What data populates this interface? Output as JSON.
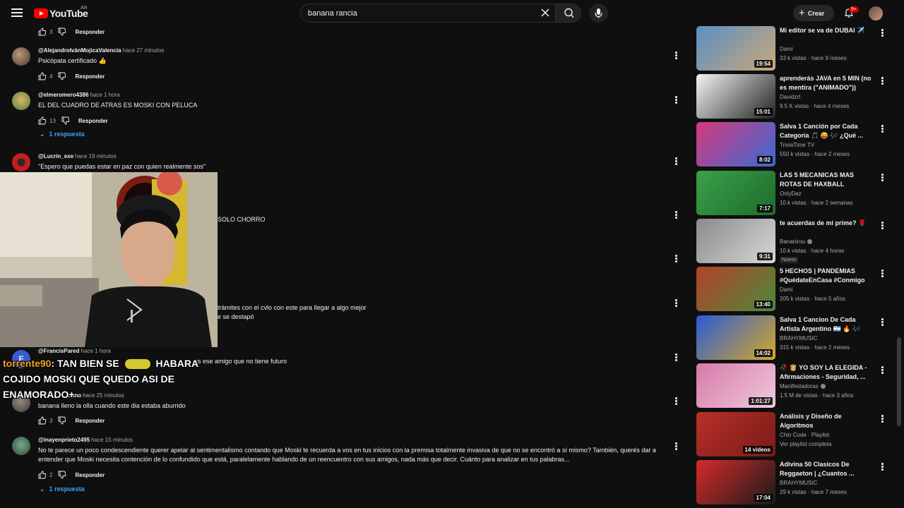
{
  "header": {
    "logo_text": "YouTube",
    "country": "AR",
    "search_value": "banana rancia",
    "create_label": "Crear",
    "notif_count": "9+"
  },
  "comments": [
    {
      "author": "",
      "time": "",
      "text": "",
      "likes": "3",
      "reply": "Responder"
    },
    {
      "author": "@AlejandroIvánMojicaValencia",
      "time": "hace 27 minutos",
      "text": "Psicópata certificado 👍",
      "likes": "4",
      "reply": "Responder"
    },
    {
      "author": "@elmeromero4386",
      "time": "hace 1 hora",
      "text": "EL DEL CUADRO DE ATRAS ES MOSKI CON PELUCA",
      "likes": "13",
      "reply": "Responder",
      "replies": "1 respuesta"
    },
    {
      "author": "@Lucrin_exe",
      "time": "hace 19 minutos",
      "text": "\"Espero que puedas estar en paz con quien realmente sos\""
    },
    {
      "text": "SOLO CHORRO"
    },
    {
      "text": "trámites con el cvlo con este para llegar a algo mejor",
      "text2": "e se destapó"
    },
    {
      "author": "@FrancisPared",
      "time": "hace 1 hora",
      "text": "os ese amigo que no tiene futuro"
    },
    {
      "author": "bano",
      "time": "hace 25 minutos",
      "text": "banana lleno la olla cuando este dia estaba aburrido",
      "likes": "3",
      "reply": "Responder"
    },
    {
      "author": "@inayenprieto2495",
      "time": "hace 15 minutos",
      "text": "No te parece un poco condescendiente querer apelar al sentimentalismo contando que Moski te recuerda a vos en tus inicios con la premisa totalmente invasiva de que no se encontró a sí mismo? También, querés dar a entender que Moski necesita contención de lo confundido que está, paralelamente hablando de un reencuentro con sus amigos, nada más que decir. Cuánto para analizar en tus palabras...",
      "likes": "2",
      "reply": "Responder",
      "replies": "1 respuesta"
    }
  ],
  "chat": {
    "user": "torrente90",
    "message_a": ": TAN BIEN SE",
    "message_b": "HABARA COJIDO MOSKI QUE QUEDO ASI DE ENAMORADO+"
  },
  "sidebar": [
    {
      "title": "Mi editor se va de DUBAI ✈️",
      "channel": "Dami",
      "meta": "33 k vistas · hace 9 meses",
      "duration": "19:54",
      "colors": [
        "#5a8fc4",
        "#c9a878"
      ]
    },
    {
      "title": "aprenderás JAVA en 5 MIN (no es mentira (\"ANIMADO\"))",
      "channel": "Davidzrt",
      "meta": "9.5 K vistas · hace 4 meses",
      "duration": "15:01",
      "colors": [
        "#f5f5f5",
        "#222222"
      ]
    },
    {
      "title": "Salva 1 Canción por Cada Categoría 🎵 😝 🎶 ¿Qué ...",
      "channel": "TriviaTime TV",
      "meta": "550 k vistas · hace 2 meses",
      "duration": "8:02",
      "colors": [
        "#d63a7a",
        "#3a6ad6"
      ]
    },
    {
      "title": "LAS 5 MECANICAS MAS ROTAS DE HAXBALL",
      "channel": "OnlyDaz",
      "meta": "10 k vistas · hace 2 semanas",
      "duration": "7:17",
      "colors": [
        "#3aa14a",
        "#1e6b2a"
      ]
    },
    {
      "title": "te acuerdas de mi prime? 🌹",
      "channel": "Bananirou",
      "meta": "10 k vistas · hace 4 horas",
      "duration": "9:31",
      "badge": "Nuevo",
      "colors": [
        "#8a8a8a",
        "#d8d8d8"
      ]
    },
    {
      "title": "5 HECHOS | PANDEMIAS #QuédateEnCasa #Conmigo",
      "channel": "Dami",
      "meta": "205 k vistas · hace 5 años",
      "duration": "13:40",
      "colors": [
        "#b5402a",
        "#4a8a3a"
      ]
    },
    {
      "title": "Salva 1 Cancion De Cada Artista Argentino 🇦🇷 🔥 🎶 ¿Cual Es T...",
      "channel": "BRAHYMUSIC",
      "meta": "315 k vistas · hace 2 meses",
      "duration": "14:02",
      "colors": [
        "#2a5ad6",
        "#d6a82a"
      ]
    },
    {
      "title": "🥀 👸 YO SOY LA ELEGIDA - Afirmaciones - Seguridad, ...",
      "channel": "Manifestadoras",
      "meta": "1.5 M de vistas · hace 3 años",
      "duration": "1:01:27",
      "colors": [
        "#d67aa8",
        "#f0c8dc"
      ]
    },
    {
      "title": "Análisis y Diseño de Algoritmos",
      "channel": "Chio Code · Playlist",
      "meta": "Ver playlist completa",
      "playlist": "14 videos",
      "colors": [
        "#b8302a",
        "#7a1a16"
      ]
    },
    {
      "title": "Adivina 50 Clasicos De Reggaeton | ¿Cuantos ...",
      "channel": "BRAHYMUSIC",
      "meta": "29 k vistas · hace 7 meses",
      "duration": "17:04",
      "colors": [
        "#d62a2a",
        "#1a1a1a"
      ]
    }
  ]
}
